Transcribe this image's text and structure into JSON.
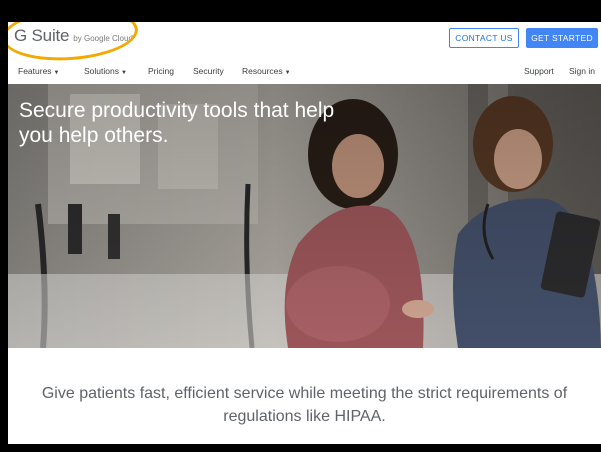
{
  "header": {
    "logo_main": "G Suite",
    "logo_sub": "by Google Cloud",
    "contact_label": "CONTACT US",
    "get_started_label": "GET STARTED"
  },
  "nav": {
    "items": [
      {
        "label": "Features",
        "has_caret": true
      },
      {
        "label": "Solutions",
        "has_caret": true
      },
      {
        "label": "Pricing",
        "has_caret": false
      },
      {
        "label": "Security",
        "has_caret": false
      },
      {
        "label": "Resources",
        "has_caret": true
      }
    ],
    "support_label": "Support",
    "signin_label": "Sign in"
  },
  "hero": {
    "title": "Secure productivity tools that help you help others.",
    "image": "doctor-with-pregnant-patient-photo"
  },
  "tagline": "Give patients fast, efficient service while meeting the strict requirements of regulations like HIPAA.",
  "colors": {
    "primary": "#4285f4",
    "highlight": "#f2a900",
    "text": "#5f6368"
  }
}
